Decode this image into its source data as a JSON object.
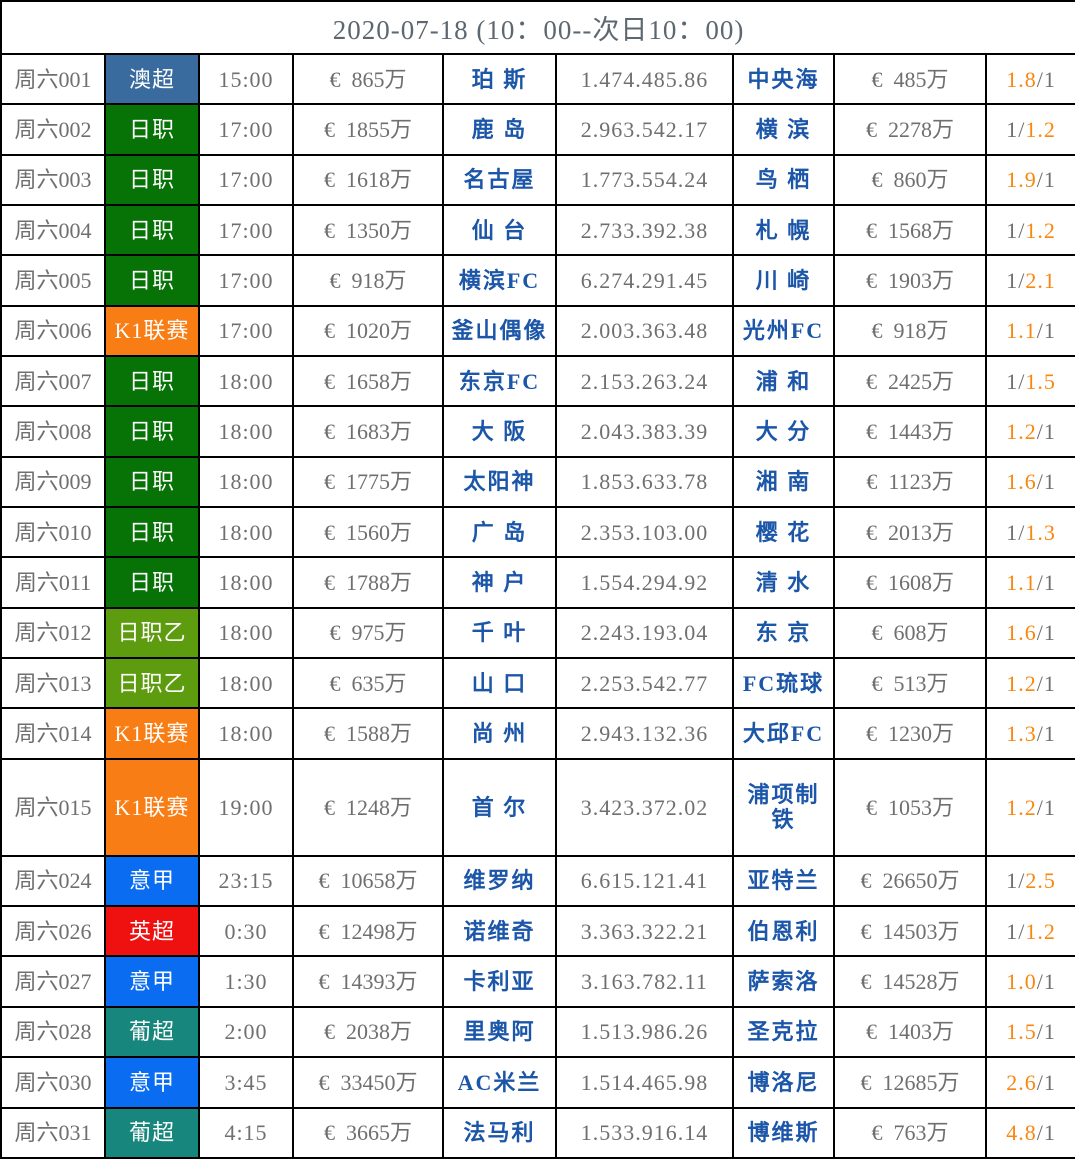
{
  "header": {
    "title": "2020-07-18 (10：00--次日10：00)"
  },
  "colors": {
    "grid_line": "#000000",
    "default_text": "#6f6f6f",
    "team_text": "#1c56a8",
    "ratio_orange": "#f9870f",
    "ratio_gray": "#6f6f6f",
    "header_text": "#5d6770"
  },
  "table": {
    "rows": [
      {
        "id": "周六001",
        "league": "澳超",
        "league_color": "#3a6b9e",
        "time": "15:00",
        "home_value": "€  865万",
        "home": "珀 斯",
        "win_draw_lose": "1.474.485.86",
        "away": "中央海",
        "away_value": "€  485万",
        "odds": [
          {
            "text": "1.8",
            "color": "#f9870f"
          },
          {
            "text": "/1",
            "color": "#6f6f6f"
          }
        ]
      },
      {
        "id": "周六002",
        "league": "日职",
        "league_color": "#077307",
        "time": "17:00",
        "home_value": "€  1855万",
        "home": "鹿 岛",
        "win_draw_lose": "2.963.542.17",
        "away": "横 滨",
        "away_value": "€  2278万",
        "odds": [
          {
            "text": "1/",
            "color": "#6f6f6f"
          },
          {
            "text": "1.2",
            "color": "#f9870f"
          }
        ]
      },
      {
        "id": "周六003",
        "league": "日职",
        "league_color": "#077307",
        "time": "17:00",
        "home_value": "€  1618万",
        "home": "名古屋",
        "win_draw_lose": "1.773.554.24",
        "away": "鸟 栖",
        "away_value": "€  860万",
        "odds": [
          {
            "text": "1.9",
            "color": "#f9870f"
          },
          {
            "text": "/1",
            "color": "#6f6f6f"
          }
        ]
      },
      {
        "id": "周六004",
        "league": "日职",
        "league_color": "#077307",
        "time": "17:00",
        "home_value": "€  1350万",
        "home": "仙 台",
        "win_draw_lose": "2.733.392.38",
        "away": "札 幌",
        "away_value": "€  1568万",
        "odds": [
          {
            "text": "1/",
            "color": "#6f6f6f"
          },
          {
            "text": "1.2",
            "color": "#f9870f"
          }
        ]
      },
      {
        "id": "周六005",
        "league": "日职",
        "league_color": "#077307",
        "time": "17:00",
        "home_value": "€  918万",
        "home": "横滨FC",
        "win_draw_lose": "6.274.291.45",
        "away": "川 崎",
        "away_value": "€  1903万",
        "odds": [
          {
            "text": "1/",
            "color": "#6f6f6f"
          },
          {
            "text": "2.1",
            "color": "#f9870f"
          }
        ]
      },
      {
        "id": "周六006",
        "league": "K1联赛",
        "league_color": "#f87d15",
        "time": "17:00",
        "home_value": "€  1020万",
        "home": "釜山偶像",
        "win_draw_lose": "2.003.363.48",
        "away": "光州FC",
        "away_value": "€  918万",
        "odds": [
          {
            "text": "1.1",
            "color": "#f9870f"
          },
          {
            "text": "/1",
            "color": "#6f6f6f"
          }
        ]
      },
      {
        "id": "周六007",
        "league": "日职",
        "league_color": "#077307",
        "time": "18:00",
        "home_value": "€  1658万",
        "home": "东京FC",
        "win_draw_lose": "2.153.263.24",
        "away": "浦 和",
        "away_value": "€  2425万",
        "odds": [
          {
            "text": "1/",
            "color": "#6f6f6f"
          },
          {
            "text": "1.5",
            "color": "#f9870f"
          }
        ]
      },
      {
        "id": "周六008",
        "league": "日职",
        "league_color": "#077307",
        "time": "18:00",
        "home_value": "€  1683万",
        "home": "大 阪",
        "win_draw_lose": "2.043.383.39",
        "away": "大 分",
        "away_value": "€  1443万",
        "odds": [
          {
            "text": "1.2",
            "color": "#f9870f"
          },
          {
            "text": "/1",
            "color": "#6f6f6f"
          }
        ]
      },
      {
        "id": "周六009",
        "league": "日职",
        "league_color": "#077307",
        "time": "18:00",
        "home_value": "€  1775万",
        "home": "太阳神",
        "win_draw_lose": "1.853.633.78",
        "away": "湘 南",
        "away_value": "€  1123万",
        "odds": [
          {
            "text": "1.6",
            "color": "#f9870f"
          },
          {
            "text": "/1",
            "color": "#6f6f6f"
          }
        ]
      },
      {
        "id": "周六010",
        "league": "日职",
        "league_color": "#077307",
        "time": "18:00",
        "home_value": "€  1560万",
        "home": "广 岛",
        "win_draw_lose": "2.353.103.00",
        "away": "樱 花",
        "away_value": "€  2013万",
        "odds": [
          {
            "text": "1/",
            "color": "#6f6f6f"
          },
          {
            "text": "1.3",
            "color": "#f9870f"
          }
        ]
      },
      {
        "id": "周六011",
        "league": "日职",
        "league_color": "#077307",
        "time": "18:00",
        "home_value": "€  1788万",
        "home": "神 户",
        "win_draw_lose": "1.554.294.92",
        "away": "清 水",
        "away_value": "€  1608万",
        "odds": [
          {
            "text": "1.1",
            "color": "#f9870f"
          },
          {
            "text": "/1",
            "color": "#6f6f6f"
          }
        ]
      },
      {
        "id": "周六012",
        "league": "日职乙",
        "league_color": "#5d9c0e",
        "time": "18:00",
        "home_value": "€  975万",
        "home": "千 叶",
        "win_draw_lose": "2.243.193.04",
        "away": "东 京",
        "away_value": "€  608万",
        "odds": [
          {
            "text": "1.6",
            "color": "#f9870f"
          },
          {
            "text": "/1",
            "color": "#6f6f6f"
          }
        ]
      },
      {
        "id": "周六013",
        "league": "日职乙",
        "league_color": "#5d9c0e",
        "time": "18:00",
        "home_value": "€  635万",
        "home": "山 口",
        "win_draw_lose": "2.253.542.77",
        "away": "FC琉球",
        "away_value": "€  513万",
        "odds": [
          {
            "text": "1.2",
            "color": "#f9870f"
          },
          {
            "text": "/1",
            "color": "#6f6f6f"
          }
        ]
      },
      {
        "id": "周六014",
        "league": "K1联赛",
        "league_color": "#f87d15",
        "time": "18:00",
        "home_value": "€  1588万",
        "home": "尚 州",
        "win_draw_lose": "2.943.132.36",
        "away": "大邱FC",
        "away_value": "€  1230万",
        "odds": [
          {
            "text": "1.3",
            "color": "#f9870f"
          },
          {
            "text": "/1",
            "color": "#6f6f6f"
          }
        ]
      },
      {
        "id": "周六015",
        "league": "K1联赛",
        "league_color": "#f87d15",
        "time": "19:00",
        "home_value": "€  1248万",
        "home": "首 尔",
        "win_draw_lose": "3.423.372.02",
        "away": "浦项制铁",
        "away_value": "€  1053万",
        "odds": [
          {
            "text": "1.2",
            "color": "#f9870f"
          },
          {
            "text": "/1",
            "color": "#6f6f6f"
          }
        ]
      },
      {
        "id": "周六024",
        "league": "意甲",
        "league_color": "#0a6cf0",
        "time": "23:15",
        "home_value": "€  10658万",
        "home": "维罗纳",
        "win_draw_lose": "6.615.121.41",
        "away": "亚特兰",
        "away_value": "€  26650万",
        "odds": [
          {
            "text": "1/",
            "color": "#6f6f6f"
          },
          {
            "text": "2.5",
            "color": "#f9870f"
          }
        ]
      },
      {
        "id": "周六026",
        "league": "英超",
        "league_color": "#ef1010",
        "time": "0:30",
        "home_value": "€  12498万",
        "home": "诺维奇",
        "win_draw_lose": "3.363.322.21",
        "away": "伯恩利",
        "away_value": "€  14503万",
        "odds": [
          {
            "text": "1/",
            "color": "#6f6f6f"
          },
          {
            "text": "1.2",
            "color": "#f9870f"
          }
        ]
      },
      {
        "id": "周六027",
        "league": "意甲",
        "league_color": "#0a6cf0",
        "time": "1:30",
        "home_value": "€  14393万",
        "home": "卡利亚",
        "win_draw_lose": "3.163.782.11",
        "away": "萨索洛",
        "away_value": "€  14528万",
        "odds": [
          {
            "text": "1.0",
            "color": "#f9870f"
          },
          {
            "text": "/1",
            "color": "#6f6f6f"
          }
        ]
      },
      {
        "id": "周六028",
        "league": "葡超",
        "league_color": "#17867d",
        "time": "2:00",
        "home_value": "€  2038万",
        "home": "里奥阿",
        "win_draw_lose": "1.513.986.26",
        "away": "圣克拉",
        "away_value": "€  1403万",
        "odds": [
          {
            "text": "1.5",
            "color": "#f9870f"
          },
          {
            "text": "/1",
            "color": "#6f6f6f"
          }
        ]
      },
      {
        "id": "周六030",
        "league": "意甲",
        "league_color": "#0a6cf0",
        "time": "3:45",
        "home_value": "€  33450万",
        "home": "AC米兰",
        "win_draw_lose": "1.514.465.98",
        "away": "博洛尼",
        "away_value": "€  12685万",
        "odds": [
          {
            "text": "2.6",
            "color": "#f9870f"
          },
          {
            "text": "/1",
            "color": "#6f6f6f"
          }
        ]
      },
      {
        "id": "周六031",
        "league": "葡超",
        "league_color": "#17867d",
        "time": "4:15",
        "home_value": "€  3665万",
        "home": "法马利",
        "win_draw_lose": "1.533.916.14",
        "away": "博维斯",
        "away_value": "€  763万",
        "odds": [
          {
            "text": "4.8",
            "color": "#f9870f"
          },
          {
            "text": "/1",
            "color": "#6f6f6f"
          }
        ]
      }
    ]
  }
}
